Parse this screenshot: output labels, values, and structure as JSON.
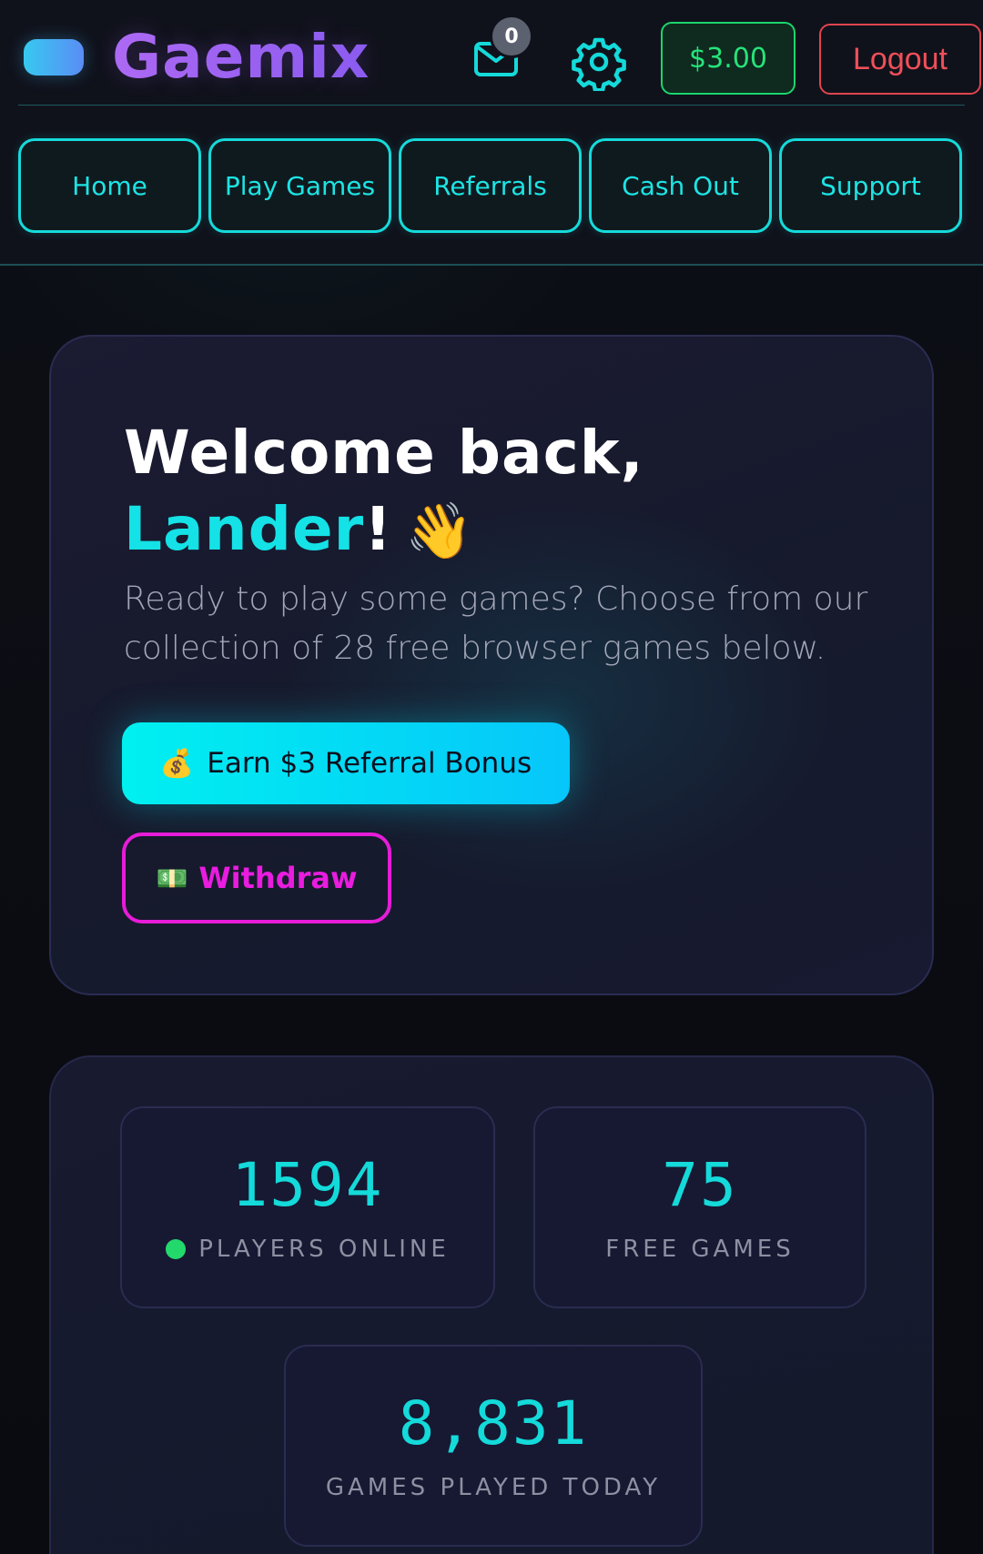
{
  "header": {
    "brand": "Gaemix",
    "mail_count": "0",
    "balance": "$3.00",
    "logout_label": "Logout",
    "icons": {
      "logo": "logo-pill-icon",
      "mail": "mail-icon",
      "settings": "gear-icon"
    }
  },
  "nav": {
    "items": [
      {
        "label": "Home"
      },
      {
        "label": "Play Games"
      },
      {
        "label": "Referrals"
      },
      {
        "label": "Cash Out"
      },
      {
        "label": "Support"
      }
    ]
  },
  "hero": {
    "welcome_prefix": "Welcome back,",
    "username": "Lander",
    "exclaim": "!",
    "wave_emoji": "👋",
    "description": "Ready to play some games? Choose from our collection of 28 free browser games below.",
    "referral_emoji": "💰",
    "referral_label": "Earn $3 Referral Bonus",
    "withdraw_emoji": "💵",
    "withdraw_label": "Withdraw"
  },
  "stats": {
    "players_online": {
      "value": "1594",
      "label": "PLAYERS ONLINE"
    },
    "free_games": {
      "value": "75",
      "label": "FREE GAMES"
    },
    "games_played": {
      "value": "8,831",
      "label": "GAMES PLAYED TODAY"
    }
  },
  "colors": {
    "accent_cyan": "#14dada",
    "brand_purple": "#9a62f2",
    "balance_green": "#26e37a",
    "logout_red": "#ef4f58",
    "withdraw_magenta": "#e91ce0"
  }
}
